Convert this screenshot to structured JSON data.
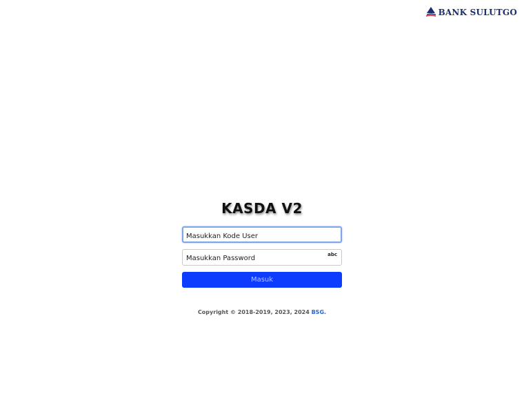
{
  "brand": {
    "name": "BANK SULUTGO",
    "logo_icon": "bank-sulutgo-logo-icon",
    "color": "#1c2f6b"
  },
  "login": {
    "title": "KASDA V2",
    "user_field": {
      "placeholder": "Masukkan Kode User",
      "value": ""
    },
    "password_field": {
      "placeholder": "Masukkan Password",
      "value": "",
      "indicator": "abc"
    },
    "submit_label": "Masuk",
    "accent_color": "#0d3cff"
  },
  "footer": {
    "copyright_text": "Copyright © 2018-2019, 2023, 2024 ",
    "company_link": "BSG",
    "suffix": "."
  }
}
